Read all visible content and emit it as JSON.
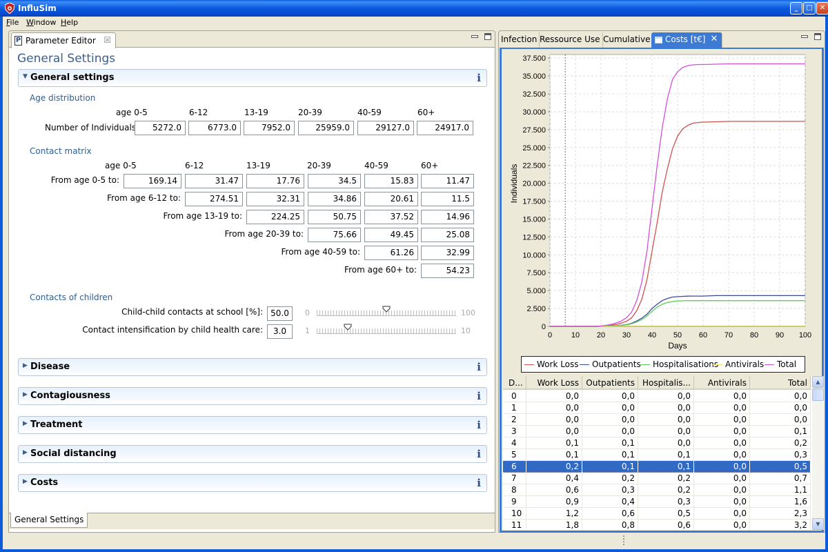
{
  "window": {
    "title": "InfluSim",
    "minimize_label": "_",
    "maximize_label": "□",
    "close_label": "✕"
  },
  "menu": [
    {
      "label": "File",
      "mnemonic": "F",
      "rest": "ile"
    },
    {
      "label": "Window",
      "mnemonic": "W",
      "rest": "indow"
    },
    {
      "label": "Help",
      "mnemonic": "H",
      "rest": "elp"
    }
  ],
  "left_panel": {
    "tab_label": "Parameter Editor",
    "tab_icon_letter": "P",
    "tab_close": "☒",
    "page_title": "General Settings",
    "general_section": {
      "label": "General settings",
      "info": "i",
      "age_distribution": {
        "title": "Age distribution",
        "age_prefix": "age",
        "age_groups": [
          "0-5",
          "6-12",
          "13-19",
          "20-39",
          "40-59",
          "60+"
        ],
        "row_label": "Number of Individuals",
        "values": [
          "5272.0",
          "6773.0",
          "7952.0",
          "25959.0",
          "29127.0",
          "24917.0"
        ]
      },
      "contact_matrix": {
        "title": "Contact matrix",
        "age_prefix": "age",
        "age_groups": [
          "0-5",
          "6-12",
          "13-19",
          "20-39",
          "40-59",
          "60+"
        ],
        "rows": [
          {
            "label": "From age 0-5 to:",
            "values": [
              "169.14",
              "31.47",
              "17.76",
              "34.5",
              "15.83",
              "11.47"
            ]
          },
          {
            "label": "From age 6-12 to:",
            "values": [
              "274.51",
              "32.31",
              "34.86",
              "20.61",
              "11.5"
            ]
          },
          {
            "label": "From age 13-19 to:",
            "values": [
              "224.25",
              "50.75",
              "37.52",
              "14.96"
            ]
          },
          {
            "label": "From age 20-39 to:",
            "values": [
              "75.66",
              "49.45",
              "25.08"
            ]
          },
          {
            "label": "From age 40-59 to:",
            "values": [
              "61.26",
              "32.99"
            ]
          },
          {
            "label": "From age 60+ to:",
            "values": [
              "54.23"
            ]
          }
        ]
      },
      "contacts_of_children": {
        "title": "Contacts of children",
        "sliders": [
          {
            "label": "Child-child contacts at school [%]:",
            "value": "50.0",
            "min_label": "0",
            "max_label": "100",
            "min": 0,
            "max": 100,
            "current": 50
          },
          {
            "label": "Contact intensification by child health care:",
            "value": "3.0",
            "min_label": "1",
            "max_label": "10",
            "min": 1,
            "max": 10,
            "current": 3
          }
        ]
      }
    },
    "collapsed_sections": [
      {
        "label": "Disease",
        "info": "i"
      },
      {
        "label": "Contagiousness",
        "info": "i"
      },
      {
        "label": "Treatment",
        "info": "i"
      },
      {
        "label": "Social distancing",
        "info": "i"
      },
      {
        "label": "Costs",
        "info": "i"
      }
    ],
    "bottom_tab": "General Settings"
  },
  "right_panel": {
    "tabs": [
      {
        "label": "Infection",
        "active": false
      },
      {
        "label": "Ressource Use",
        "active": false
      },
      {
        "label": "Cumulative",
        "active": false
      },
      {
        "label": "Costs [t€]",
        "active": true
      }
    ],
    "active_tab_close": "✕",
    "table": {
      "columns": [
        "D...",
        "Work Loss",
        "Outpatients",
        "Hospitalis...",
        "Antivirals",
        "Total"
      ],
      "selected_row": 6,
      "rows": [
        [
          "0",
          "0,0",
          "0,0",
          "0,0",
          "0,0",
          "0,0"
        ],
        [
          "1",
          "0,0",
          "0,0",
          "0,0",
          "0,0",
          "0,0"
        ],
        [
          "2",
          "0,0",
          "0,0",
          "0,0",
          "0,0",
          "0,0"
        ],
        [
          "3",
          "0,0",
          "0,0",
          "0,0",
          "0,0",
          "0,1"
        ],
        [
          "4",
          "0,1",
          "0,1",
          "0,0",
          "0,0",
          "0,2"
        ],
        [
          "5",
          "0,1",
          "0,1",
          "0,1",
          "0,0",
          "0,3"
        ],
        [
          "6",
          "0,2",
          "0,1",
          "0,1",
          "0,0",
          "0,5"
        ],
        [
          "7",
          "0,4",
          "0,2",
          "0,2",
          "0,0",
          "0,7"
        ],
        [
          "8",
          "0,6",
          "0,3",
          "0,2",
          "0,0",
          "1,1"
        ],
        [
          "9",
          "0,9",
          "0,4",
          "0,3",
          "0,0",
          "1,6"
        ],
        [
          "10",
          "1,2",
          "0,6",
          "0,5",
          "0,0",
          "2,3"
        ],
        [
          "11",
          "1,8",
          "0,8",
          "0,6",
          "0,0",
          "3,2"
        ]
      ]
    }
  },
  "chart_data": {
    "type": "line",
    "title": "",
    "xlabel": "Days",
    "ylabel": "Individuals",
    "xlim": [
      0,
      100
    ],
    "ylim": [
      0,
      38000
    ],
    "xticks": [
      0,
      10,
      20,
      30,
      40,
      50,
      60,
      70,
      80,
      90,
      100
    ],
    "yticks": [
      0,
      2500,
      5000,
      7500,
      10000,
      12500,
      15000,
      17500,
      20000,
      22500,
      25000,
      27500,
      30000,
      32500,
      35000,
      37500
    ],
    "ytick_labels": [
      "0",
      "2.500",
      "5.000",
      "7.500",
      "10.000",
      "12.500",
      "15.000",
      "17.500",
      "20.000",
      "22.500",
      "25.000",
      "27.500",
      "30.000",
      "32.500",
      "35.000",
      "37.500"
    ],
    "grid": true,
    "marker_line_x": 6,
    "legend_position": "bottom",
    "x": [
      0,
      10,
      18,
      20,
      22,
      24,
      26,
      28,
      30,
      32,
      34,
      36,
      38,
      40,
      42,
      44,
      46,
      48,
      50,
      52,
      54,
      56,
      58,
      60,
      65,
      70,
      80,
      90,
      100
    ],
    "series": [
      {
        "name": "Work Loss",
        "color": "#d0504a",
        "values": [
          0,
          0,
          0,
          30,
          80,
          150,
          280,
          450,
          700,
          1200,
          2200,
          3800,
          6500,
          10500,
          14500,
          18800,
          22000,
          24800,
          26600,
          27600,
          28100,
          28400,
          28500,
          28550,
          28600,
          28650,
          28650,
          28650,
          28650
        ]
      },
      {
        "name": "Outpatients",
        "color": "#3a4a9a",
        "values": [
          0,
          0,
          0,
          20,
          40,
          70,
          110,
          160,
          250,
          420,
          750,
          1150,
          1700,
          2500,
          3100,
          3600,
          3900,
          4100,
          4150,
          4200,
          4220,
          4230,
          4230,
          4230,
          4300,
          4300,
          4300,
          4300,
          4300
        ]
      },
      {
        "name": "Hospitalisations",
        "color": "#5ad05a",
        "values": [
          0,
          0,
          0,
          15,
          30,
          55,
          90,
          140,
          220,
          360,
          620,
          950,
          1450,
          2100,
          2700,
          3100,
          3350,
          3450,
          3550,
          3580,
          3600,
          3600,
          3600,
          3600,
          3600,
          3600,
          3600,
          3600,
          3600
        ]
      },
      {
        "name": "Antivirals",
        "color": "#e8e060",
        "values": [
          0,
          0,
          0,
          0,
          0,
          0,
          0,
          0,
          0,
          0,
          0,
          0,
          0,
          0,
          0,
          0,
          0,
          0,
          0,
          0,
          0,
          0,
          0,
          0,
          0,
          0,
          0,
          0,
          0
        ]
      },
      {
        "name": "Total",
        "color": "#d050d8",
        "values": [
          0,
          0,
          0,
          60,
          150,
          280,
          480,
          750,
          1200,
          2000,
          3600,
          6200,
          10500,
          16500,
          22500,
          27800,
          31800,
          34500,
          35600,
          36200,
          36450,
          36550,
          36600,
          36600,
          36650,
          36700,
          36700,
          36700,
          36700
        ]
      }
    ]
  }
}
